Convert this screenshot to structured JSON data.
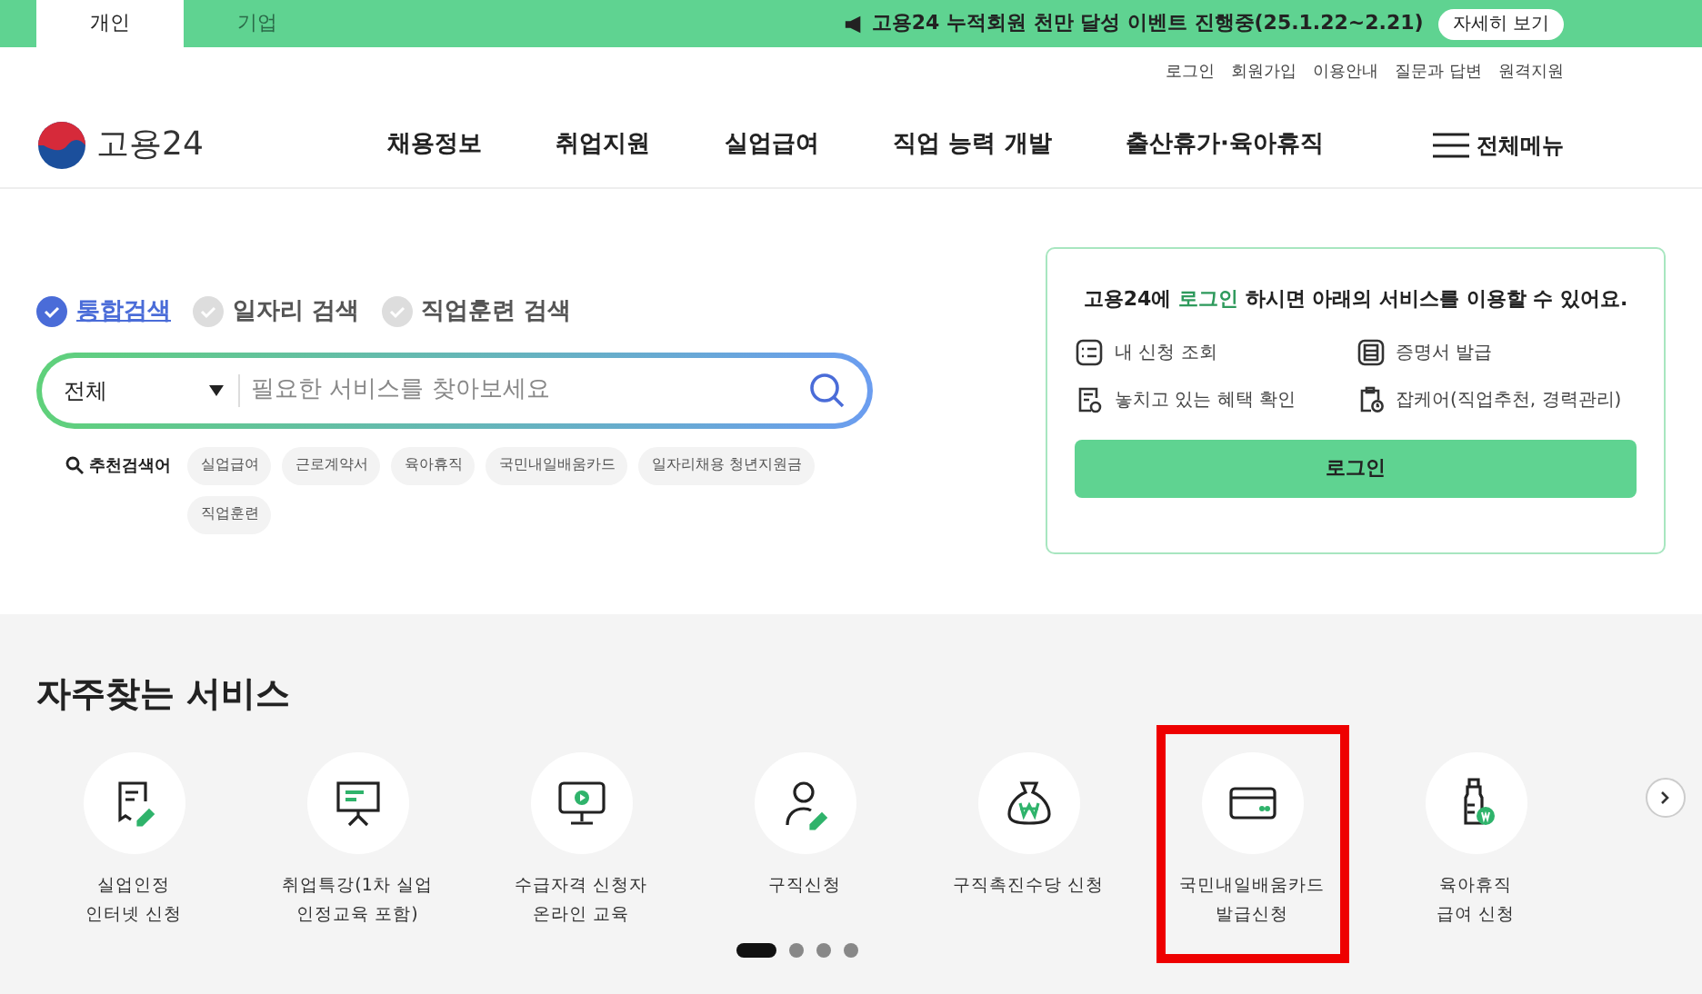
{
  "top_bar": {
    "tabs": [
      {
        "label": "개인",
        "selected": true
      },
      {
        "label": "기업",
        "selected": false
      }
    ],
    "notice": "고용24 누적회원 천만 달성 이벤트 진행중(25.1.22~2.21)",
    "notice_button": "자세히 보기"
  },
  "utility_links": [
    "로그인",
    "회원가입",
    "이용안내",
    "질문과 답변",
    "원격지원"
  ],
  "header": {
    "logo": "고용24",
    "nav": [
      "채용정보",
      "취업지원",
      "실업급여",
      "직업 능력 개발",
      "출산휴가·육아휴직"
    ],
    "all_menu": "전체메뉴"
  },
  "search": {
    "tabs": [
      {
        "label": "통합검색",
        "selected": true
      },
      {
        "label": "일자리 검색",
        "selected": false
      },
      {
        "label": "직업훈련 검색",
        "selected": false
      }
    ],
    "category": "전체",
    "placeholder": "필요한 서비스를 찾아보세요",
    "recommended_label": "추천검색어",
    "keywords": [
      "실업급여",
      "근로계약서",
      "육아휴직",
      "국민내일배움카드",
      "일자리채용 청년지원금",
      "직업훈련"
    ]
  },
  "login_panel": {
    "message_prefix": "고용24에",
    "message_highlight": "로그인",
    "message_suffix": "하시면 아래의 서비스를 이용할 수 있어요.",
    "services": [
      {
        "kind": "list",
        "label": "내 신청 조회"
      },
      {
        "kind": "certificate",
        "label": "증명서 발급"
      },
      {
        "kind": "document",
        "label": "놓치고 있는 혜택 확인"
      },
      {
        "kind": "clipboard",
        "label": "잡케어(직업추천, 경력관리)"
      }
    ],
    "button": "로그인"
  },
  "frequent_services": {
    "title": "자주찾는 서비스",
    "items": [
      {
        "kind": "document-pen",
        "lines": [
          "실업인정",
          "인터넷 신청"
        ],
        "highlighted": false
      },
      {
        "kind": "presentation",
        "lines": [
          "취업특강(1차 실업",
          "인정교육 포함)"
        ],
        "highlighted": false
      },
      {
        "kind": "monitor",
        "lines": [
          "수급자격 신청자",
          "온라인 교육"
        ],
        "highlighted": false
      },
      {
        "kind": "person",
        "lines": [
          "구직신청"
        ],
        "highlighted": false
      },
      {
        "kind": "money-bag",
        "lines": [
          "구직촉진수당 신청"
        ],
        "highlighted": false
      },
      {
        "kind": "card",
        "lines": [
          "국민내일배움카드",
          "발급신청"
        ],
        "highlighted": true
      },
      {
        "kind": "bottle",
        "lines": [
          "육아휴직",
          "급여 신청"
        ],
        "highlighted": false
      }
    ],
    "pager": [
      {
        "selected": true
      },
      {
        "selected": false
      },
      {
        "selected": false
      },
      {
        "selected": false
      }
    ]
  }
}
